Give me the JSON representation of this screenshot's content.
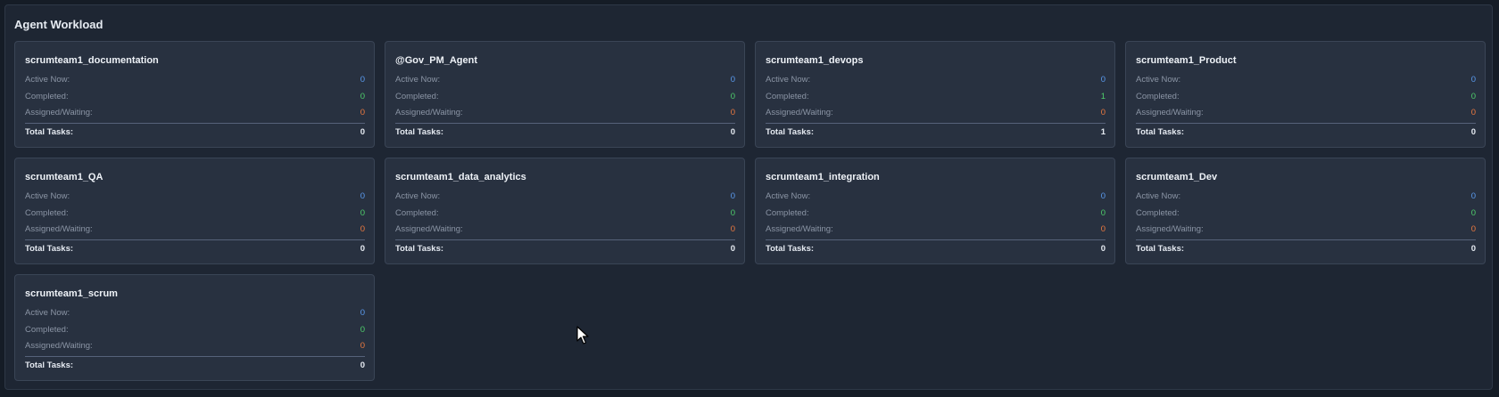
{
  "panel": {
    "title": "Agent Workload"
  },
  "labels": {
    "active": "Active Now:",
    "completed": "Completed:",
    "assigned": "Assigned/Waiting:",
    "total": "Total Tasks:"
  },
  "agents": [
    {
      "name": "scrumteam1_documentation",
      "active": "0",
      "completed": "0",
      "assigned": "0",
      "total": "0"
    },
    {
      "name": "@Gov_PM_Agent",
      "active": "0",
      "completed": "0",
      "assigned": "0",
      "total": "0"
    },
    {
      "name": "scrumteam1_devops",
      "active": "0",
      "completed": "1",
      "assigned": "0",
      "total": "1"
    },
    {
      "name": "scrumteam1_Product",
      "active": "0",
      "completed": "0",
      "assigned": "0",
      "total": "0"
    },
    {
      "name": "scrumteam1_QA",
      "active": "0",
      "completed": "0",
      "assigned": "0",
      "total": "0"
    },
    {
      "name": "scrumteam1_data_analytics",
      "active": "0",
      "completed": "0",
      "assigned": "0",
      "total": "0"
    },
    {
      "name": "scrumteam1_integration",
      "active": "0",
      "completed": "0",
      "assigned": "0",
      "total": "0"
    },
    {
      "name": "scrumteam1_Dev",
      "active": "0",
      "completed": "0",
      "assigned": "0",
      "total": "0"
    },
    {
      "name": "scrumteam1_scrum",
      "active": "0",
      "completed": "0",
      "assigned": "0",
      "total": "0"
    }
  ],
  "colors": {
    "active": "#5b9cf0",
    "completed": "#4fcf6b",
    "assigned": "#ee7a3f"
  }
}
